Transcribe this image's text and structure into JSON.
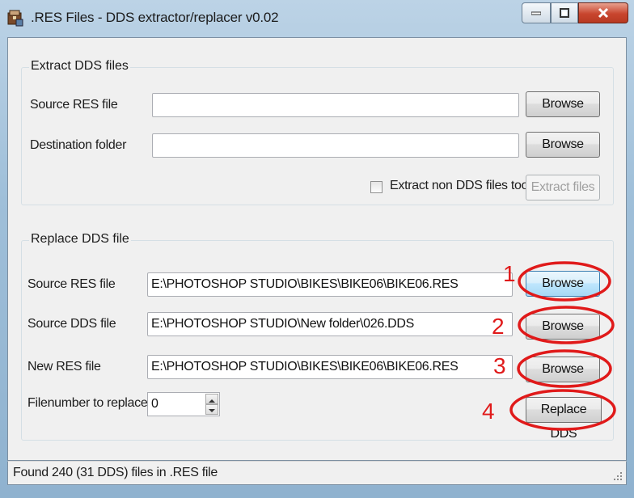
{
  "window": {
    "title": ".RES Files - DDS extractor/replacer v0.02",
    "icon": "archive-app-icon"
  },
  "extract": {
    "group_label": "Extract DDS files",
    "source_label": "Source RES file",
    "source_value": "",
    "source_browse": "Browse",
    "dest_label": "Destination folder",
    "dest_value": "",
    "dest_browse": "Browse",
    "non_dds_label": "Extract non DDS files too",
    "non_dds_checked": false,
    "extract_button": "Extract files"
  },
  "replace": {
    "group_label": "Replace DDS file",
    "source_res_label": "Source RES file",
    "source_res_value": "E:\\PHOTOSHOP STUDIO\\BIKES\\BIKE06\\BIKE06.RES",
    "source_res_browse": "Browse",
    "source_dds_label": "Source DDS file",
    "source_dds_value": "E:\\PHOTOSHOP STUDIO\\New folder\\026.DDS",
    "source_dds_browse": "Browse",
    "new_res_label": "New RES file",
    "new_res_value": "E:\\PHOTOSHOP STUDIO\\BIKES\\BIKE06\\BIKE06.RES",
    "new_res_browse": "Browse",
    "filenumber_label": "Filenumber to replace",
    "filenumber_value": "0",
    "replace_button": "Replace DDS"
  },
  "status": {
    "text": "Found 240 (31 DDS) files in .RES file"
  },
  "annotations": {
    "color": "#e01a1a",
    "numbers": [
      "1",
      "2",
      "3",
      "4"
    ]
  }
}
